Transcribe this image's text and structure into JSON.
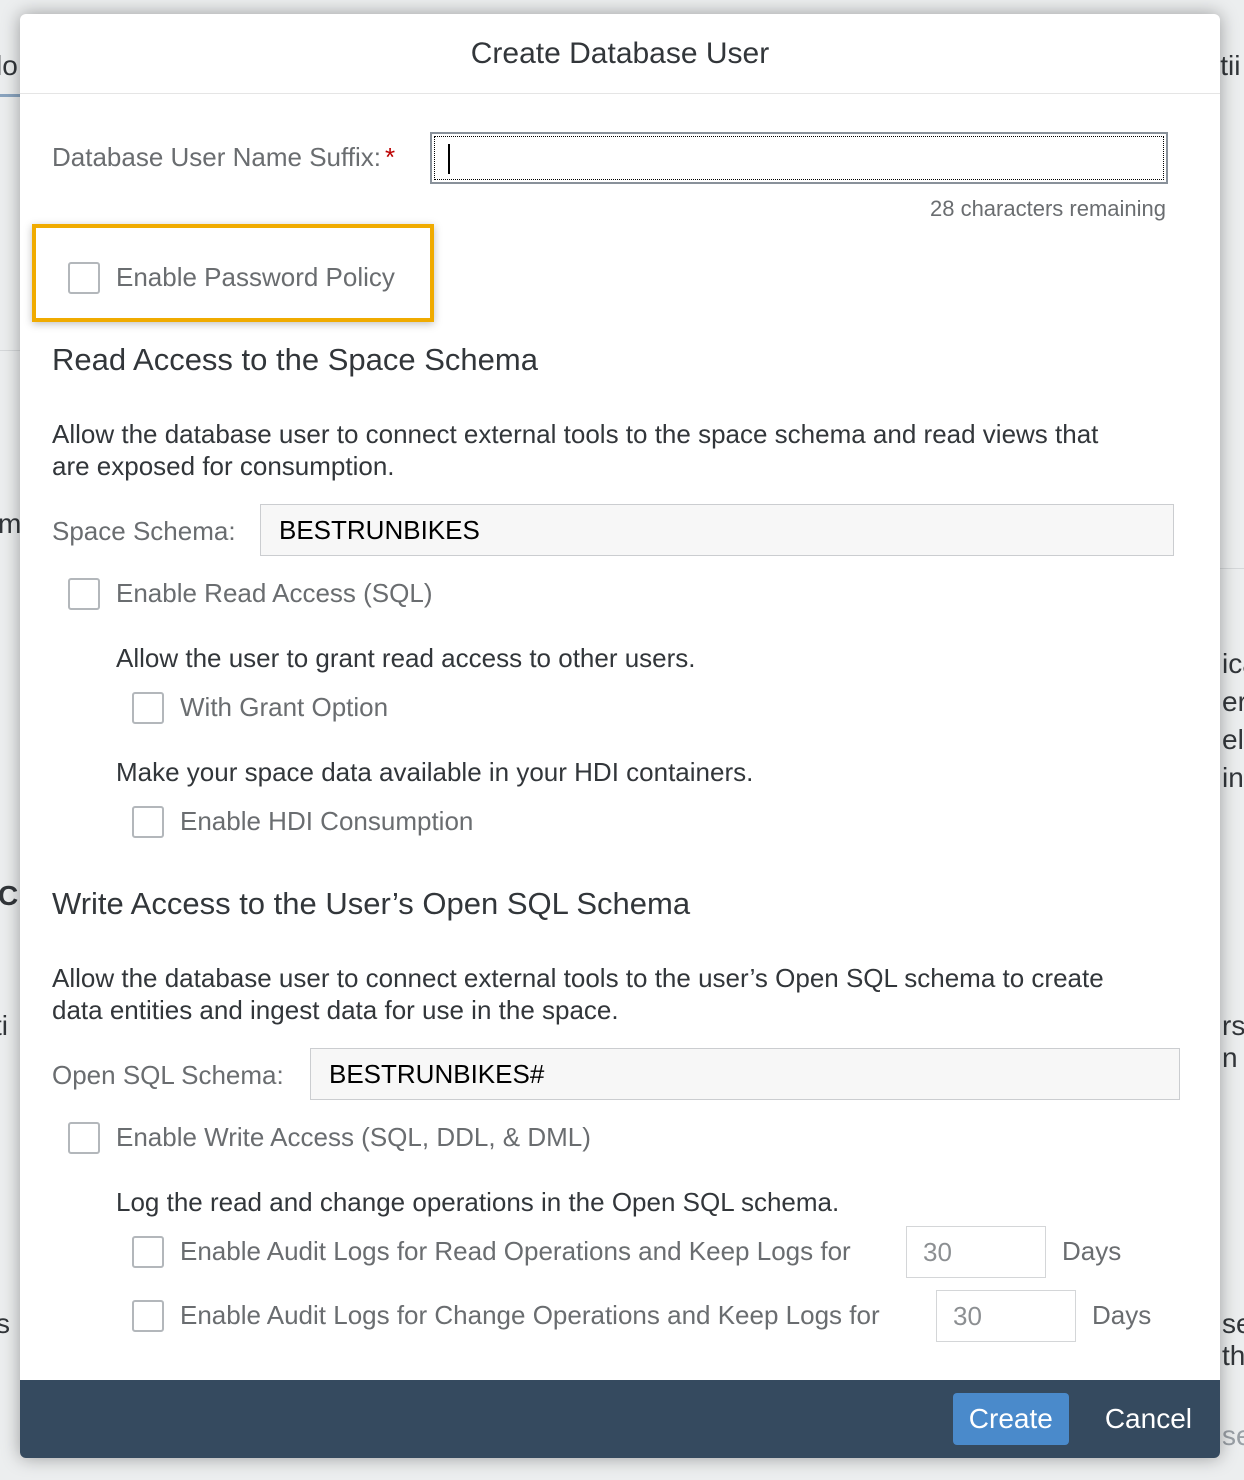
{
  "background": {
    "fragments": [
      "lo",
      "itii",
      "m",
      "C",
      "ti",
      "s",
      "ica",
      "er",
      "ele",
      "in.",
      "rs",
      "n a",
      "se",
      "th",
      "se"
    ]
  },
  "dialog": {
    "title": "Create Database User",
    "suffix": {
      "label": "Database User Name Suffix:",
      "required_marker": "*",
      "value": "",
      "remaining": "28 characters remaining"
    },
    "password_policy": {
      "label": "Enable Password Policy",
      "checked": false
    },
    "read_section": {
      "heading": "Read Access to the Space Schema",
      "description_line1": "Allow the database user to connect external tools to the space schema and read views that",
      "description_line2": "are exposed for consumption.",
      "schema_label": "Space Schema:",
      "schema_value": "BESTRUNBIKES",
      "enable_read": {
        "label": "Enable Read Access (SQL)",
        "checked": false
      },
      "grant_text": "Allow the user to grant read access to other users.",
      "with_grant": {
        "label": "With Grant Option",
        "checked": false
      },
      "hdi_text": "Make your space data available in your HDI containers.",
      "enable_hdi": {
        "label": "Enable HDI Consumption",
        "checked": false
      }
    },
    "write_section": {
      "heading": "Write Access to the User’s Open SQL Schema",
      "description_line1": "Allow the database user to connect external tools to the user’s Open SQL schema to create",
      "description_line2": "data entities and ingest data for use in the space.",
      "schema_label": "Open SQL Schema:",
      "schema_value": "BESTRUNBIKES#",
      "enable_write": {
        "label": "Enable Write Access (SQL, DDL, & DML)",
        "checked": false
      },
      "log_text": "Log the read and change operations in the Open SQL schema.",
      "audit_read": {
        "label": "Enable Audit Logs for Read Operations and Keep Logs for",
        "days": "30",
        "unit": "Days",
        "checked": false
      },
      "audit_change": {
        "label": "Enable Audit Logs for Change Operations and Keep Logs for",
        "days": "30",
        "unit": "Days",
        "checked": false
      }
    },
    "footer": {
      "create_label": "Create",
      "cancel_label": "Cancel"
    }
  },
  "colors": {
    "highlight": "#f0ab00",
    "footer_bg": "#354a5f",
    "primary_button": "#4a8acb",
    "required": "#bb0000"
  }
}
